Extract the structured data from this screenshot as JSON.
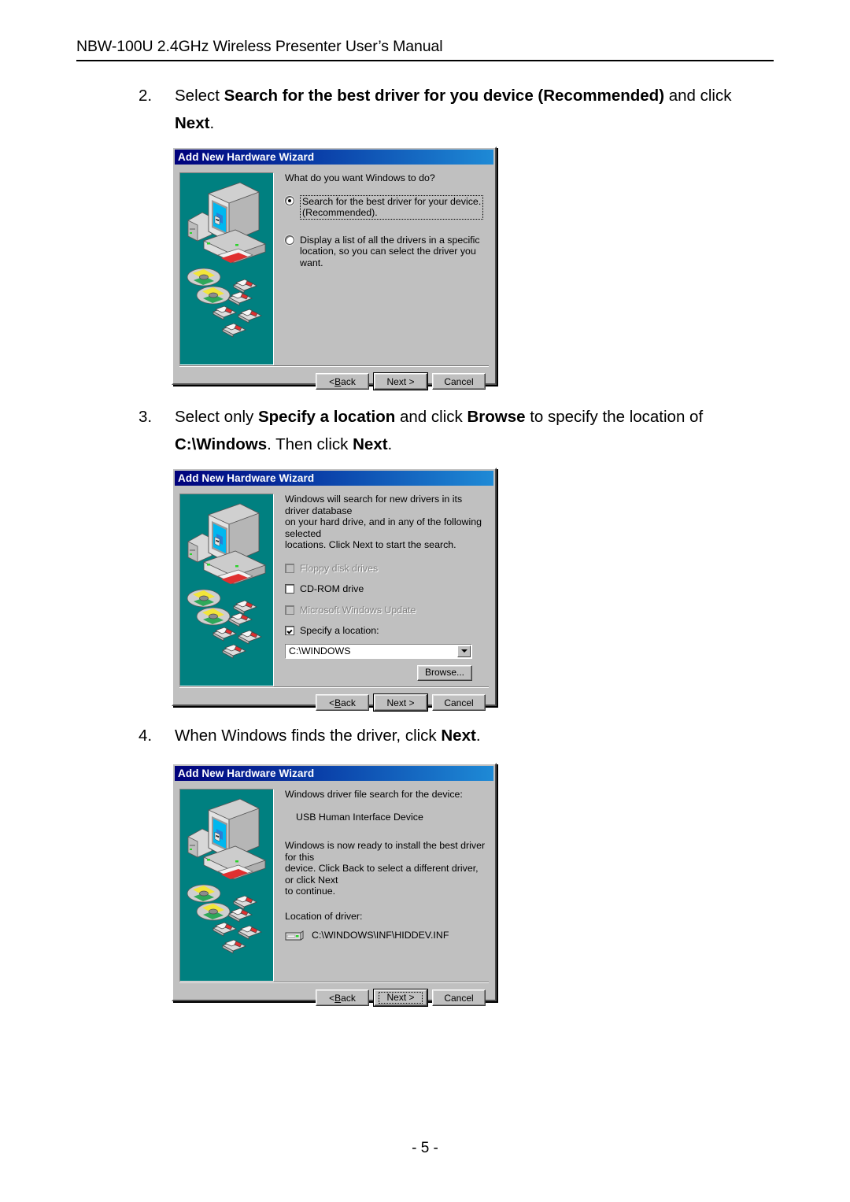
{
  "header": {
    "title": "NBW-100U 2.4GHz Wireless Presenter User’s Manual"
  },
  "steps": [
    {
      "number": "2.",
      "parts": [
        {
          "t": "Select ",
          "b": false
        },
        {
          "t": "Search for the best driver for you device (Recommended)",
          "b": true
        },
        {
          "t": " and click ",
          "b": false
        },
        {
          "t": "Next",
          "b": true
        },
        {
          "t": ".",
          "b": false
        }
      ]
    },
    {
      "number": "3.",
      "parts": [
        {
          "t": "Select only ",
          "b": false
        },
        {
          "t": "Specify a location",
          "b": true
        },
        {
          "t": " and click ",
          "b": false
        },
        {
          "t": "Browse",
          "b": true
        },
        {
          "t": " to specify the location of ",
          "b": false
        },
        {
          "t": "C:\\Windows",
          "b": true
        },
        {
          "t": ". Then click ",
          "b": false
        },
        {
          "t": "Next",
          "b": true
        },
        {
          "t": ".",
          "b": false
        }
      ]
    },
    {
      "number": "4.",
      "parts": [
        {
          "t": "When Windows finds the driver, click ",
          "b": false
        },
        {
          "t": "Next",
          "b": true
        },
        {
          "t": ".",
          "b": false
        }
      ]
    }
  ],
  "dialog1": {
    "title": "Add New Hardware Wizard",
    "prompt": "What do you want Windows to do?",
    "options": [
      {
        "label_line1": "Search for the best driver for your device.",
        "label_line2": "(Recommended).",
        "selected": true
      },
      {
        "label_line1": "Display a list of all the drivers in a specific",
        "label_line2": "location, so you can select the driver you want.",
        "selected": false
      }
    ],
    "buttons": {
      "back": "< Back",
      "back_pre": "< ",
      "back_accel": "B",
      "back_post": "ack",
      "next": "Next >",
      "cancel": "Cancel"
    }
  },
  "dialog2": {
    "title": "Add New Hardware Wizard",
    "body_line1": "Windows will search for new drivers in its driver database",
    "body_line2": "on your hard drive, and in any of the following selected",
    "body_line3": "locations. Click Next to start the search.",
    "checkboxes": [
      {
        "label": "Floppy disk drives",
        "checked": false,
        "enabled": false
      },
      {
        "label": "CD-ROM drive",
        "checked": false,
        "enabled": true
      },
      {
        "label": "Microsoft Windows Update",
        "checked": false,
        "enabled": false
      },
      {
        "label": "Specify a location:",
        "checked": true,
        "enabled": true
      }
    ],
    "location_value": "C:\\WINDOWS",
    "browse_label": "Browse...",
    "buttons": {
      "back_pre": "< ",
      "back_accel": "B",
      "back_post": "ack",
      "next": "Next >",
      "cancel": "Cancel"
    }
  },
  "dialog3": {
    "title": "Add New Hardware Wizard",
    "search_label": "Windows driver file search for the device:",
    "device_name": "USB Human Interface Device",
    "ready_line1": "Windows is now ready to install the best driver for this",
    "ready_line2": "device. Click Back to select a different driver, or click Next",
    "ready_line3": "to continue.",
    "location_label": "Location of driver:",
    "driver_path": "C:\\WINDOWS\\INF\\HIDDEV.INF",
    "buttons": {
      "back_pre": "< ",
      "back_accel": "B",
      "back_post": "ack",
      "next": "Next >",
      "cancel": "Cancel"
    }
  },
  "footer": {
    "page_number": "- 5 -"
  },
  "colors": {
    "titlebar_start": "#00007b",
    "titlebar_end": "#1e8ad6",
    "dialog_face": "#c0c0c0",
    "graphic_bg": "#008080",
    "screen_blue": "#00b7ef"
  }
}
